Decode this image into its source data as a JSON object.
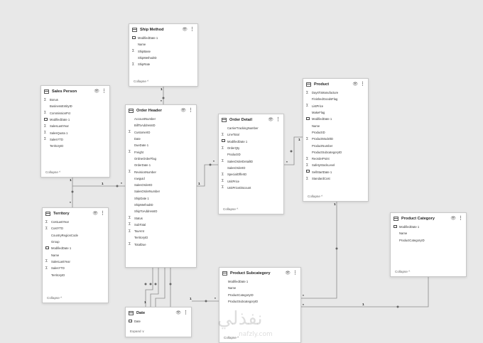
{
  "tables": {
    "ship_method": {
      "title": "Ship Method",
      "fields": [
        {
          "icon": "cal",
          "name": "ModifiedDate 1"
        },
        {
          "icon": "",
          "name": "Name"
        },
        {
          "icon": "sigma",
          "name": "ShipBase"
        },
        {
          "icon": "",
          "name": "ShipMethodID"
        },
        {
          "icon": "sigma",
          "name": "ShipRate"
        }
      ],
      "footer": "Collapse ^"
    },
    "sales_person": {
      "title": "Sales Person",
      "fields": [
        {
          "icon": "sigma",
          "name": "Bonus"
        },
        {
          "icon": "",
          "name": "BusinessEntityID"
        },
        {
          "icon": "sigma",
          "name": "CommissionPct"
        },
        {
          "icon": "cal",
          "name": "ModifiedDate 1"
        },
        {
          "icon": "sigma",
          "name": "SalesLastYear"
        },
        {
          "icon": "sigma",
          "name": "SalesQuota 1"
        },
        {
          "icon": "sigma",
          "name": "SalesYTD"
        },
        {
          "icon": "",
          "name": "TerritoryID"
        }
      ],
      "footer": "Collapse ^"
    },
    "order_header": {
      "title": "Order Header",
      "fields": [
        {
          "icon": "",
          "name": "AccountNumber"
        },
        {
          "icon": "",
          "name": "BillToAddressID"
        },
        {
          "icon": "sigma",
          "name": "CustomerID"
        },
        {
          "icon": "",
          "name": "Date"
        },
        {
          "icon": "",
          "name": "DueDate 1"
        },
        {
          "icon": "sigma",
          "name": "Freight"
        },
        {
          "icon": "",
          "name": "OnlineOrderFlag"
        },
        {
          "icon": "",
          "name": "OrderDate 1"
        },
        {
          "icon": "sigma",
          "name": "RevisionNumber"
        },
        {
          "icon": "",
          "name": "rowguid"
        },
        {
          "icon": "",
          "name": "SalesOrderID"
        },
        {
          "icon": "",
          "name": "SalesOrderNumber"
        },
        {
          "icon": "",
          "name": "ShipDate 1"
        },
        {
          "icon": "",
          "name": "ShipMethodID"
        },
        {
          "icon": "",
          "name": "ShipToAddressID"
        },
        {
          "icon": "sigma",
          "name": "Status"
        },
        {
          "icon": "sigma",
          "name": "SubTotal"
        },
        {
          "icon": "sigma",
          "name": "TaxAmt"
        },
        {
          "icon": "",
          "name": "TerritoryID"
        },
        {
          "icon": "sigma",
          "name": "TotalDue"
        }
      ],
      "footer": ""
    },
    "order_detail": {
      "title": "Order Detail",
      "fields": [
        {
          "icon": "",
          "name": "CarrierTrackingNumber"
        },
        {
          "icon": "sigma",
          "name": "LineTotal"
        },
        {
          "icon": "cal",
          "name": "ModifiedDate 1"
        },
        {
          "icon": "sigma",
          "name": "OrderQty"
        },
        {
          "icon": "",
          "name": "ProductID"
        },
        {
          "icon": "sigma",
          "name": "SalesOrderDetailID"
        },
        {
          "icon": "",
          "name": "SalesOrderID"
        },
        {
          "icon": "sigma",
          "name": "SpecialOfferID"
        },
        {
          "icon": "sigma",
          "name": "UnitPrice"
        },
        {
          "icon": "sigma",
          "name": "UnitPriceDiscount"
        }
      ],
      "footer": "Collapse ^"
    },
    "product": {
      "title": "Product",
      "fields": [
        {
          "icon": "sigma",
          "name": "DaysToManufacture"
        },
        {
          "icon": "",
          "name": "FinishedGoodsFlag"
        },
        {
          "icon": "sigma",
          "name": "ListPrice"
        },
        {
          "icon": "",
          "name": "MakeFlag"
        },
        {
          "icon": "cal",
          "name": "ModifiedDate 1"
        },
        {
          "icon": "",
          "name": "Name"
        },
        {
          "icon": "",
          "name": "ProductID"
        },
        {
          "icon": "sigma",
          "name": "ProductModelID"
        },
        {
          "icon": "",
          "name": "ProductNumber"
        },
        {
          "icon": "",
          "name": "ProductSubcategoryID"
        },
        {
          "icon": "sigma",
          "name": "ReorderPoint"
        },
        {
          "icon": "sigma",
          "name": "SafetyStockLevel"
        },
        {
          "icon": "cal",
          "name": "SellStartDate 1"
        },
        {
          "icon": "sigma",
          "name": "StandardCost"
        }
      ],
      "footer": "Collapse ^"
    },
    "territory": {
      "title": "Territory",
      "fields": [
        {
          "icon": "sigma",
          "name": "CostLastYear"
        },
        {
          "icon": "sigma",
          "name": "CostYTD"
        },
        {
          "icon": "",
          "name": "CountryRegionCode"
        },
        {
          "icon": "",
          "name": "Group"
        },
        {
          "icon": "cal",
          "name": "ModifiedDate 1"
        },
        {
          "icon": "",
          "name": "Name"
        },
        {
          "icon": "sigma",
          "name": "SalesLastYear"
        },
        {
          "icon": "sigma",
          "name": "SalesYTD"
        },
        {
          "icon": "",
          "name": "TerritoryID"
        }
      ],
      "footer": "Collapse ^"
    },
    "product_category": {
      "title": "Product Category",
      "fields": [
        {
          "icon": "cal",
          "name": "ModifiedDate 1"
        },
        {
          "icon": "",
          "name": "Name"
        },
        {
          "icon": "",
          "name": "ProductCategoryID"
        }
      ],
      "footer": "Collapse ^"
    },
    "product_subcategory": {
      "title": "Product Subcategory",
      "fields": [
        {
          "icon": "",
          "name": "ModifiedDate 1"
        },
        {
          "icon": "",
          "name": "Name"
        },
        {
          "icon": "",
          "name": "ProductCategoryID"
        },
        {
          "icon": "",
          "name": "ProductSubcategoryID"
        }
      ],
      "footer": "Collapse ^"
    },
    "date": {
      "title": "Date",
      "fields": [
        {
          "icon": "cal",
          "name": "Date"
        }
      ],
      "footer": "Expand ∨"
    }
  },
  "relationship_labels": {
    "one": "1",
    "many": "*"
  },
  "icons": {
    "table": "table-icon",
    "visibility": "eye-icon",
    "more": "more-options-icon",
    "sum": "sigma-icon",
    "date": "calendar-icon"
  },
  "colors": {
    "canvas": "#e8e8e8",
    "card": "#ffffff",
    "line": "#8a8a8a"
  },
  "watermark": {
    "text": "نفذلي",
    "url": "nafzly.com"
  }
}
